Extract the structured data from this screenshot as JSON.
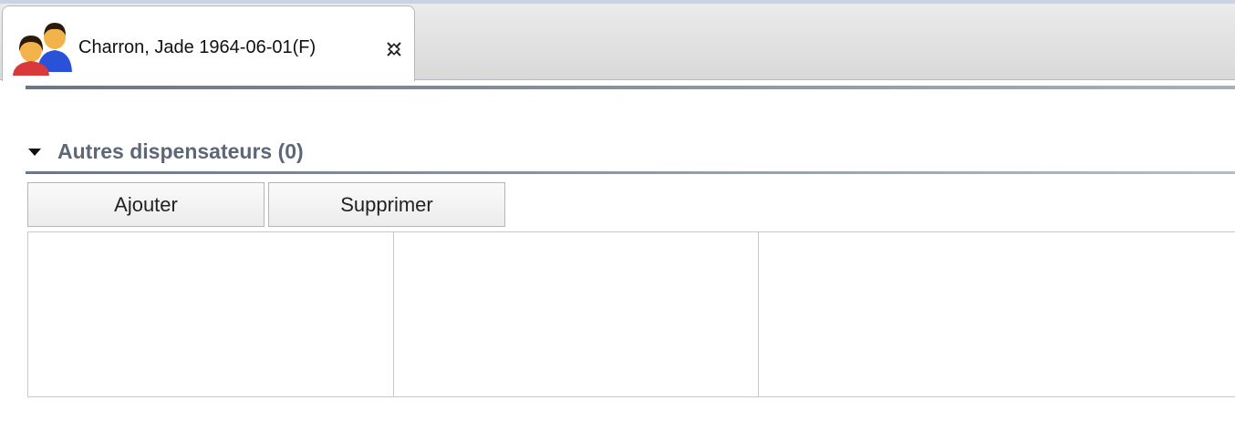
{
  "tab": {
    "label": "Charron, Jade 1964-06-01(F)",
    "icon": "patient-couple-icon",
    "close_icon": "close-icon"
  },
  "section": {
    "title": "Autres dispensateurs (0)",
    "expanded": true,
    "toggle_icon": "triangle-down-icon"
  },
  "buttons": {
    "add_label": "Ajouter",
    "delete_label": "Supprimer"
  },
  "table": {
    "columns": [
      "",
      "",
      ""
    ],
    "rows": []
  },
  "colors": {
    "section_title": "#5c6777",
    "rule": "#6b7685",
    "person_red": "#d8393b",
    "person_blue": "#2a52d8"
  }
}
